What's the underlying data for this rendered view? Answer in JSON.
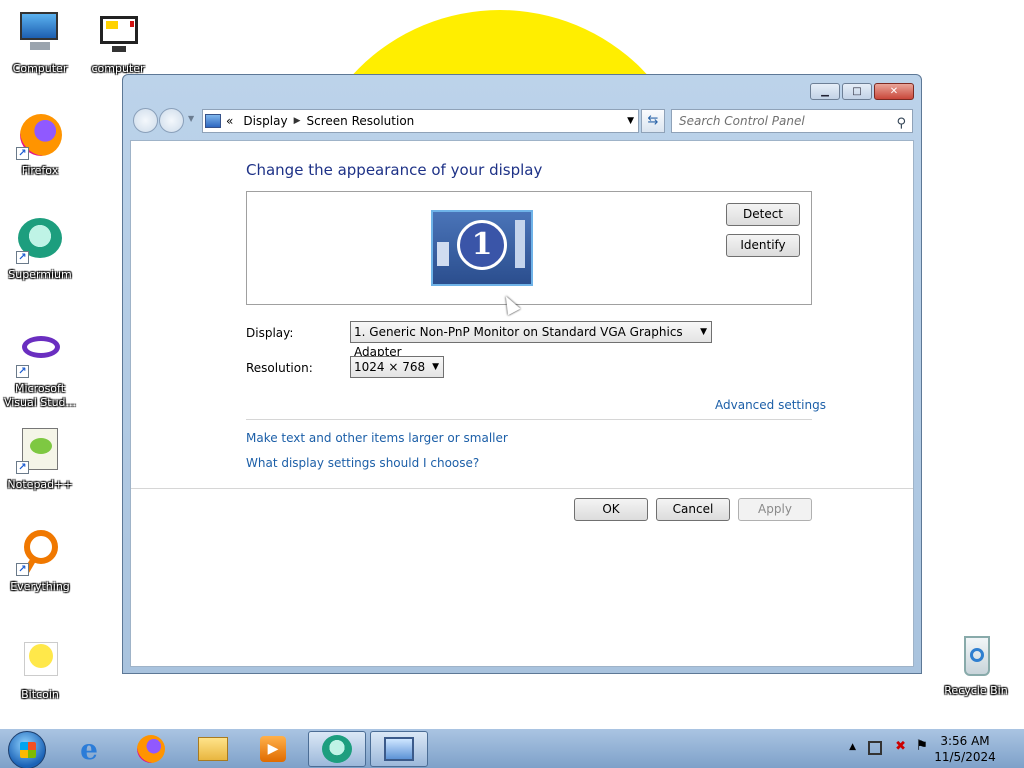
{
  "desktop": {
    "icons": [
      {
        "label": "Computer"
      },
      {
        "label": "computer"
      },
      {
        "label": "Firefox"
      },
      {
        "label": "Supermium"
      },
      {
        "label": "Microsoft Visual Stud..."
      },
      {
        "label": "Notepad++"
      },
      {
        "label": "Everything"
      },
      {
        "label": "Bitcoin"
      },
      {
        "label": "Recycle Bin"
      }
    ]
  },
  "window": {
    "breadcrumb": {
      "overflow": "«",
      "items": [
        "Display",
        "Screen Resolution"
      ]
    },
    "search": {
      "placeholder": "Search Control Panel"
    },
    "title": "Change the appearance of your display",
    "monitor_number": "1",
    "buttons": {
      "detect": "Detect",
      "identify": "Identify",
      "ok": "OK",
      "cancel": "Cancel",
      "apply": "Apply"
    },
    "display": {
      "label": "Display:",
      "value": "1. Generic Non-PnP Monitor on Standard VGA Graphics Adapter"
    },
    "resolution": {
      "label": "Resolution:",
      "value": "1024 × 768"
    },
    "links": {
      "advanced": "Advanced settings",
      "text_size": "Make text and other items larger or smaller",
      "help": "What display settings should I choose?"
    }
  },
  "taskbar": {
    "clock": {
      "time": "3:56 AM",
      "date": "11/5/2024"
    }
  },
  "colors": {
    "title_blue": "#1e3287",
    "link_blue": "#1c5fa8",
    "sun_yellow": "#ffee00"
  }
}
